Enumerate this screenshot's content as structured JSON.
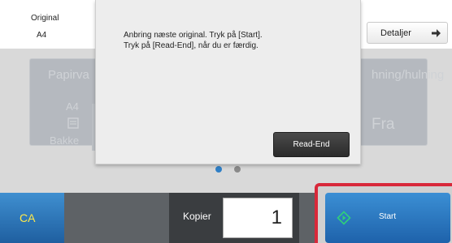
{
  "original": {
    "label": "Original",
    "value": "A4"
  },
  "details_button": {
    "label": "Detaljer"
  },
  "function_area": {
    "paper_label_fragment": "Papirva",
    "paper_size": "A4",
    "tray_label": "Bakke",
    "staple_fragment": "hning/hulning",
    "staple_value": "Fra"
  },
  "dialog": {
    "line1": "Anbring næste original. Tryk på [Start].",
    "line2": "Tryk på [Read-End], når du er færdig.",
    "read_end_label": "Read-End"
  },
  "bottom_bar": {
    "ca_label": "CA",
    "copies_label": "Kopier",
    "copies_value": "1",
    "start_label": "Start"
  },
  "colors": {
    "accent_blue": "#2f7fc6",
    "highlight_red": "#d8283a",
    "ca_text": "#ffe94a",
    "start_icon": "#2fd07a"
  },
  "icons": {
    "details": "arrow-right-icon",
    "next": "play-icon",
    "start": "diamond-start-icon",
    "tray": "tray-icon"
  },
  "pagination": {
    "current": 1,
    "total": 2
  }
}
